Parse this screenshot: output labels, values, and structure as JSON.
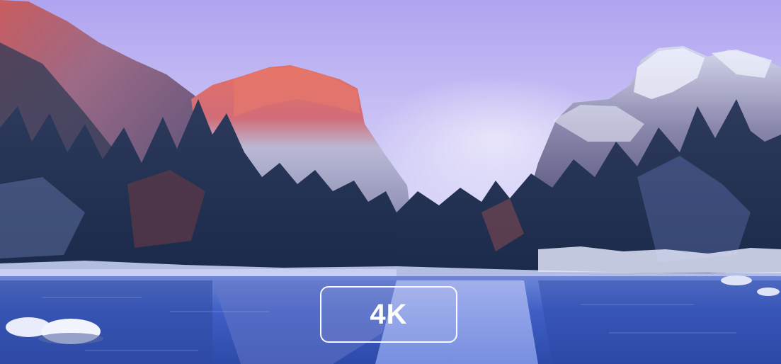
{
  "badge": {
    "label": "4K"
  },
  "scene": {
    "subject": "snowy-mountain-valley-with-river-at-dusk",
    "colors": {
      "sky_top": "#b3a6f2",
      "sky_bottom": "#e4e6fb",
      "cliff_glow": "#e0706a",
      "water": "#3d5ec4",
      "snow": "#e8ecfb"
    }
  }
}
